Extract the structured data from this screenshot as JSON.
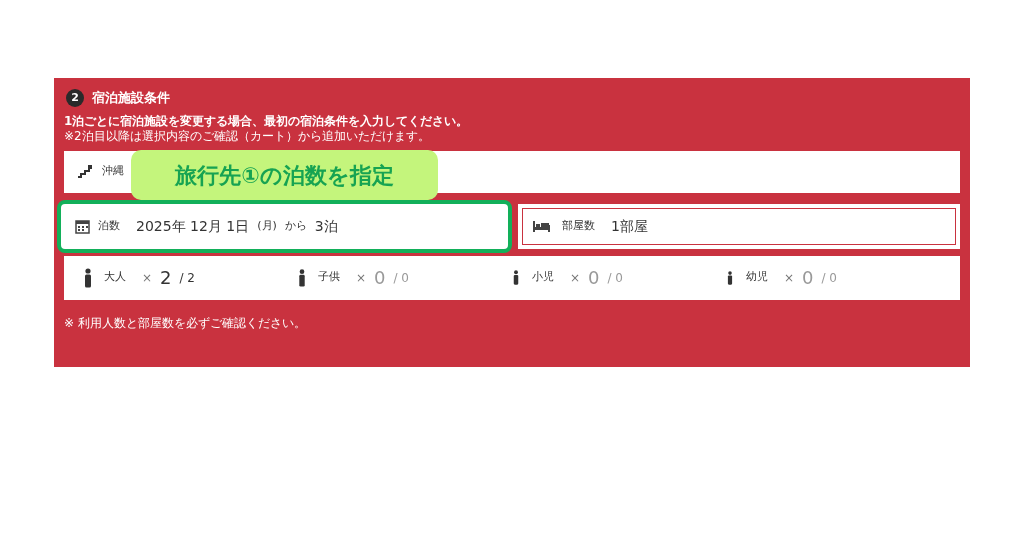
{
  "section": {
    "number": "2",
    "title": "宿泊施設条件",
    "notes": [
      "1泊ごとに宿泊施設を変更する場合、最初の宿泊条件を入力してください。",
      "※2泊目以降は選択内容のご確認（カート）から追加いただけます。"
    ]
  },
  "destination": {
    "value": "沖縄"
  },
  "callout": {
    "text": "旅行先①の泊数を指定"
  },
  "nights": {
    "label": "泊数",
    "date": "2025年 12月 1日",
    "weekday": "(月)",
    "from": "から",
    "count": "3泊",
    "highlighted": true
  },
  "rooms": {
    "label": "部屋数",
    "value": "1部屋"
  },
  "guests": [
    {
      "label": "大人",
      "times": "×",
      "count": "2",
      "max": "/ 2",
      "active": true
    },
    {
      "label": "子供",
      "times": "×",
      "count": "0",
      "max": "/ 0",
      "active": false
    },
    {
      "label": "小児",
      "times": "×",
      "count": "0",
      "max": "/ 0",
      "active": false
    },
    {
      "label": "幼児",
      "times": "×",
      "count": "0",
      "max": "/ 0",
      "active": false
    }
  ],
  "footnote": "※ 利用人数と部屋数を必ずご確認ください。"
}
